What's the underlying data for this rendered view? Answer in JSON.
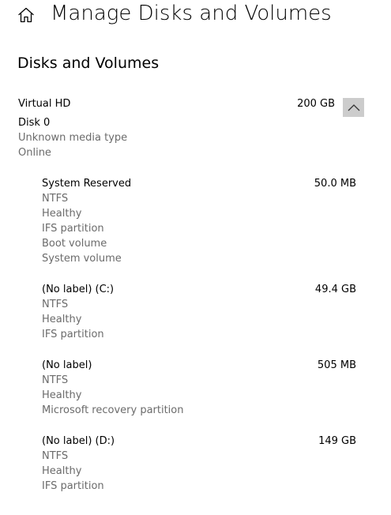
{
  "header": {
    "title": "Manage Disks and Volumes",
    "home_icon": "home-icon"
  },
  "section": {
    "title": "Disks and Volumes"
  },
  "disk": {
    "name": "Virtual HD",
    "size": "200 GB",
    "number": "Disk 0",
    "media_type": "Unknown media type",
    "status": "Online",
    "toggle_icon": "chevron-up-icon",
    "volumes": [
      {
        "name": "System Reserved",
        "size": "50.0 MB",
        "details": [
          "NTFS",
          "Healthy",
          "IFS partition",
          "Boot volume",
          "System volume"
        ]
      },
      {
        "name": "(No label) (C:)",
        "size": "49.4 GB",
        "details": [
          "NTFS",
          "Healthy",
          "IFS partition"
        ]
      },
      {
        "name": "(No label)",
        "size": "505 MB",
        "details": [
          "NTFS",
          "Healthy",
          "Microsoft recovery partition"
        ]
      },
      {
        "name": "(No label) (D:)",
        "size": "149 GB",
        "details": [
          "NTFS",
          "Healthy",
          "IFS partition"
        ]
      }
    ]
  }
}
